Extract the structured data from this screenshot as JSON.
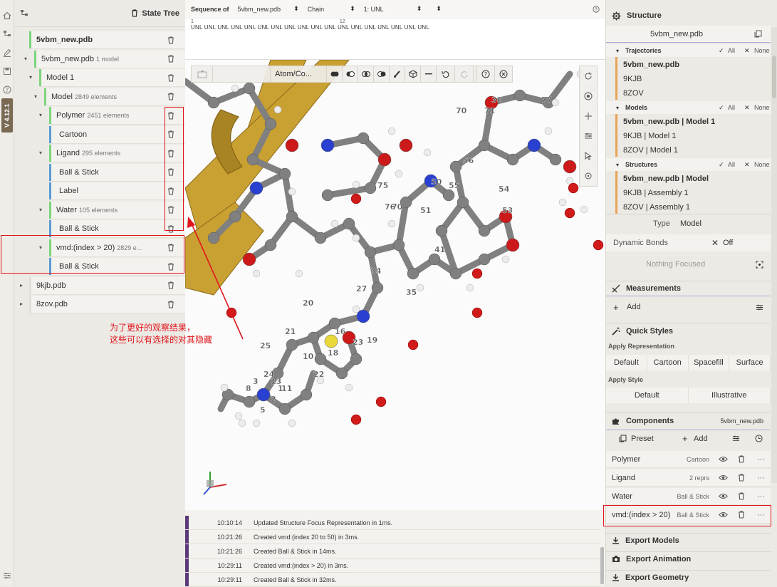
{
  "app": {
    "version": "V 4.12.1"
  },
  "state_tree": {
    "title": "State Tree",
    "rows": [
      {
        "label": "5vbm_new.pdb",
        "sub": "",
        "eye": "visible"
      },
      {
        "label": "5vbm_new.pdb",
        "sub": "1 model",
        "eye": "visible"
      },
      {
        "label": "Model 1",
        "sub": "",
        "eye": "visible"
      },
      {
        "label": "Model",
        "sub": "2849 elements",
        "eye": "visible"
      },
      {
        "label": "Polymer",
        "sub": "2451 elements",
        "eye": "visible"
      },
      {
        "label": "Cartoon",
        "sub": "",
        "eye": "visible"
      },
      {
        "label": "Ligand",
        "sub": "295 elements",
        "eye": "visible"
      },
      {
        "label": "Ball & Stick",
        "sub": "",
        "eye": "visible"
      },
      {
        "label": "Label",
        "sub": "",
        "eye": "visible"
      },
      {
        "label": "Water",
        "sub": "105 elements",
        "eye": "visible"
      },
      {
        "label": "Ball & Stick",
        "sub": "",
        "eye": "visible"
      },
      {
        "label": "vmd:(index > 20)",
        "sub": "2829 e...",
        "eye": "visible"
      },
      {
        "label": "Ball & Stick",
        "sub": "",
        "eye": "visible"
      },
      {
        "label": "9kjb.pdb",
        "sub": "",
        "eye": "hidden"
      },
      {
        "label": "8zov.pdb",
        "sub": "",
        "eye": "hidden"
      }
    ]
  },
  "sequence": {
    "label": "Sequence of",
    "structure": "5vbm_new.pdb",
    "mode": "Chain",
    "chain": "1: UNL",
    "tick_1": "1",
    "tick_2": "12",
    "residues": "UNL UNL UNL UNL UNL UNL UNL UNL UNL UNL UNL UNL UNL UNL UNL UNL UNL UNL"
  },
  "viewport": {
    "toolbar_select": "Atom/Co...",
    "atom_labels": [
      "30",
      "70",
      "71",
      "77",
      "56",
      "55",
      "54",
      "53",
      "51",
      "50",
      "41",
      "27",
      "35",
      "34",
      "20",
      "21",
      "16",
      "19",
      "18",
      "10",
      "23",
      "22",
      "25",
      "24",
      "13",
      "11",
      "2",
      "3",
      "5",
      "8",
      "1",
      "76",
      "75",
      "70"
    ]
  },
  "log": [
    {
      "time": "10:10:14",
      "message": "Updated Structure Focus Representation in 1ms."
    },
    {
      "time": "10:21:26",
      "message": "Created vmd:(index 20 to 50) in 3ms."
    },
    {
      "time": "10:21:26",
      "message": "Created Ball & Stick in 14ms."
    },
    {
      "time": "10:29:11",
      "message": "Created vmd:(index > 20) in 3ms."
    },
    {
      "time": "10:29:11",
      "message": "Created Ball & Stick in 32ms."
    }
  ],
  "structure_panel": {
    "title": "Structure",
    "current": "5vbm_new.pdb",
    "groups": [
      {
        "name": "Trajectories",
        "all": "All",
        "none": "None",
        "items": [
          "5vbm_new.pdb",
          "9KJB",
          "8ZOV"
        ]
      },
      {
        "name": "Models",
        "all": "All",
        "none": "None",
        "items": [
          "5vbm_new.pdb | Model 1",
          "9KJB | Model 1",
          "8ZOV | Model 1"
        ]
      },
      {
        "name": "Structures",
        "all": "All",
        "none": "None",
        "items": [
          "5vbm_new.pdb | Model",
          "9KJB | Assembly 1",
          "8ZOV | Assembly 1"
        ]
      }
    ],
    "type_label": "Type",
    "type_value": "Model",
    "dynamic_bonds_label": "Dynamic Bonds",
    "dynamic_bonds_value": "Off",
    "nothing_focused": "Nothing Focused"
  },
  "measurements": {
    "title": "Measurements",
    "add": "Add"
  },
  "quick_styles": {
    "title": "Quick Styles",
    "apply_representation": "Apply Representation",
    "representations": [
      "Default",
      "Cartoon",
      "Spacefill",
      "Surface"
    ],
    "apply_style": "Apply Style",
    "styles": [
      "Default",
      "Illustrative"
    ]
  },
  "components": {
    "title": "Components",
    "structure": "5vbm_new.pdb",
    "preset": "Preset",
    "add": "Add",
    "items": [
      {
        "name": "Polymer",
        "repr": "Cartoon"
      },
      {
        "name": "Ligand",
        "repr": "2 reprs"
      },
      {
        "name": "Water",
        "repr": "Ball & Stick"
      },
      {
        "name": "vmd:(index > 20)",
        "repr": "Ball & Stick"
      }
    ]
  },
  "export": {
    "models": "Export Models",
    "animation": "Export Animation",
    "geometry": "Export Geometry"
  },
  "annotation": {
    "line1": "为了更好的观察结果，",
    "line2": "这些可以有选择的对其隐藏"
  },
  "colors": {
    "accent_red": "#e0161c",
    "ribbon": "#c9a032",
    "carbon": "#808080",
    "oxygen": "#cc1a1a",
    "nitrogen": "#2a40d0",
    "sulfur": "#e8d83a",
    "log_bar": "#5a3a78"
  }
}
